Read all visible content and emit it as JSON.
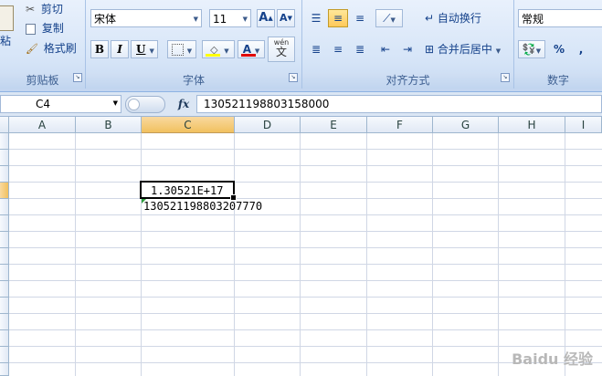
{
  "ribbon": {
    "clipboard": {
      "paste_label": "粘贴",
      "cut_label": "剪切",
      "copy_label": "复制",
      "format_painter_label": "格式刷",
      "group_label": "剪贴板"
    },
    "font": {
      "font_name": "宋体",
      "font_size": "11",
      "grow_font": "A",
      "shrink_font": "A",
      "bold": "B",
      "italic": "I",
      "underline": "U",
      "font_color_letter": "A",
      "phonetic_top": "wén",
      "phonetic_bottom": "文",
      "group_label": "字体"
    },
    "alignment": {
      "wrap_text_label": "自动换行",
      "merge_center_label": "合并后居中",
      "group_label": "对齐方式"
    },
    "number": {
      "format_value": "常规",
      "percent": "%",
      "comma": ",",
      "group_label": "数字"
    }
  },
  "formula_bar": {
    "name_box": "C4",
    "fx_label": "fx",
    "formula": "130521198803158000"
  },
  "sheet": {
    "columns": [
      "A",
      "B",
      "C",
      "D",
      "E",
      "F",
      "G",
      "H",
      "I"
    ],
    "selected_column": "C",
    "active_cell_display": "1.30521E+17",
    "next_cell_text": "130521198803207770"
  },
  "watermark": "Baidu 经验",
  "colors": {
    "selected_header": "#f1c15f",
    "gridline": "#d0d7e5",
    "ribbon_bg": "#cfdff4",
    "font_color_bar": "#e00000",
    "fill_color_bar": "#ffff00"
  }
}
